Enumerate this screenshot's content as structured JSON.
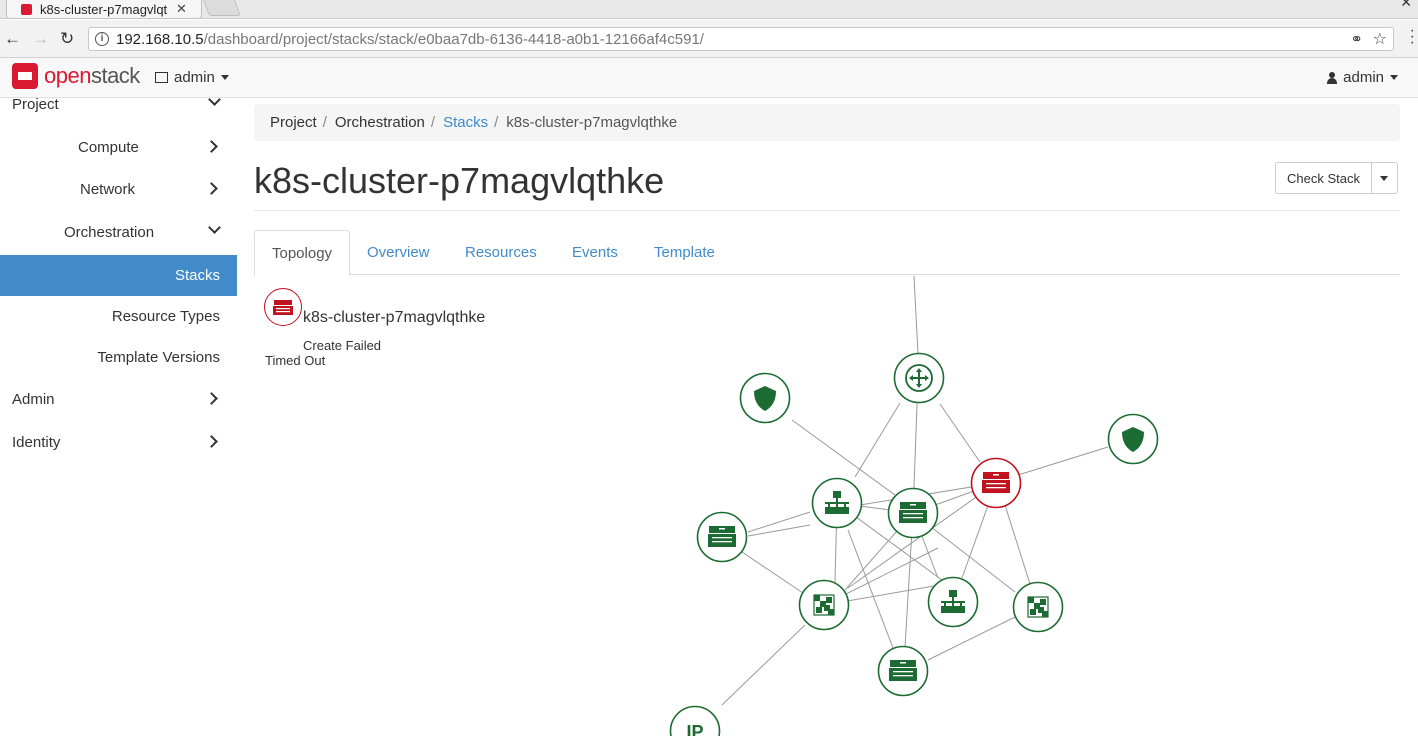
{
  "browser": {
    "tab_title": "k8s-cluster-p7magvlqthke",
    "url_host": "192.168.10.5",
    "url_path": "/dashboard/project/stacks/stack/e0baa7db-6136-4418-a0b1-12166af4c591/"
  },
  "header": {
    "logo_text_1": "open",
    "logo_text_2": "stack",
    "project_picker": "admin",
    "user_menu": "admin"
  },
  "sidebar": {
    "project": "Project",
    "compute": "Compute",
    "network": "Network",
    "orchestration": "Orchestration",
    "stacks": "Stacks",
    "resource_types": "Resource Types",
    "template_versions": "Template Versions",
    "admin": "Admin",
    "identity": "Identity"
  },
  "breadcrumb": {
    "project": "Project",
    "orchestration": "Orchestration",
    "stacks": "Stacks",
    "current": "k8s-cluster-p7magvlqthke",
    "sep": "/"
  },
  "page": {
    "title": "k8s-cluster-p7magvlqthke",
    "check_button": "Check Stack"
  },
  "tabs": {
    "topology": "Topology",
    "overview": "Overview",
    "resources": "Resources",
    "events": "Events",
    "template": "Template"
  },
  "stack": {
    "name": "k8s-cluster-p7magvlqthke",
    "status": "Create Failed",
    "reason": "Timed Out"
  },
  "topology": {
    "colors": {
      "ok": "#1c6b32",
      "failed": "#c1121f"
    },
    "nodes": [
      {
        "id": "router",
        "type": "router",
        "status": "ok"
      },
      {
        "id": "secgroup-1",
        "type": "shield",
        "status": "ok"
      },
      {
        "id": "secgroup-2",
        "type": "shield",
        "status": "ok"
      },
      {
        "id": "stack-failed",
        "type": "server",
        "status": "failed"
      },
      {
        "id": "network-1",
        "type": "network",
        "status": "ok"
      },
      {
        "id": "server-center",
        "type": "server",
        "status": "ok"
      },
      {
        "id": "server-left",
        "type": "server",
        "status": "ok"
      },
      {
        "id": "port-1",
        "type": "port",
        "status": "ok"
      },
      {
        "id": "network-2",
        "type": "network",
        "status": "ok"
      },
      {
        "id": "port-2",
        "type": "port",
        "status": "ok"
      },
      {
        "id": "server-bottom",
        "type": "server",
        "status": "ok"
      },
      {
        "id": "floating-ip",
        "type": "ip",
        "status": "ok",
        "label": "IP"
      }
    ]
  }
}
